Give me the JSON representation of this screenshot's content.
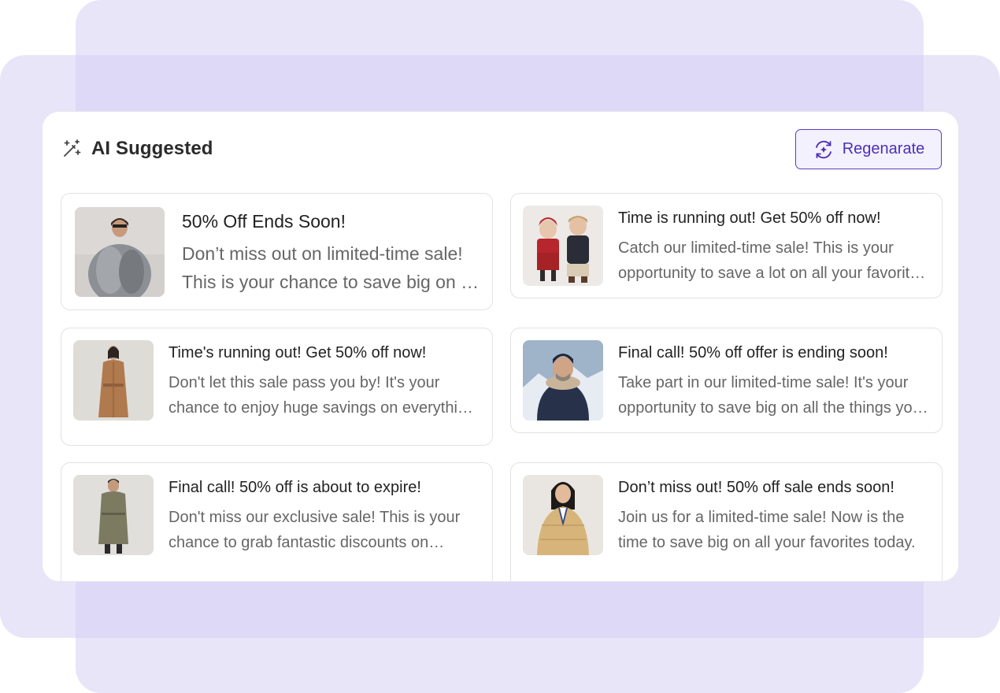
{
  "header": {
    "title": "AI Suggested",
    "regenerate_label": "Regenarate"
  },
  "cards": [
    {
      "title": "50% Off Ends Soon!",
      "desc": "Don’t miss out on limited-time sale! This is your chance to save big on all your favorites.",
      "image": "woman-fur-coat"
    },
    {
      "title": "Time is running out! Get 50% off now!",
      "desc": "Catch our limited-time sale! This is your opportunity to save a lot on all your favorite items.",
      "image": "two-children"
    },
    {
      "title": "Time's running out! Get 50% off now!",
      "desc": "Don't let this sale pass you by! It's your chance to enjoy huge savings on everything you love.",
      "image": "woman-camel-coat"
    },
    {
      "title": "Final call! 50% off offer is ending soon!",
      "desc": "Take part in our limited-time sale! It's your opportunity to save big on all the things you love.",
      "image": "man-puffer-jacket"
    },
    {
      "title": "Final call! 50% off is about to expire!",
      "desc": "Don't miss our exclusive sale! This is your chance to grab fantastic discounts on everything.",
      "image": "man-trench-coat"
    },
    {
      "title": "Don’t miss out! 50% off sale ends soon!",
      "desc": "Join us for a limited-time sale! Now is the time to save big on all your favorites today.",
      "image": "woman-puffer-jacket"
    }
  ]
}
